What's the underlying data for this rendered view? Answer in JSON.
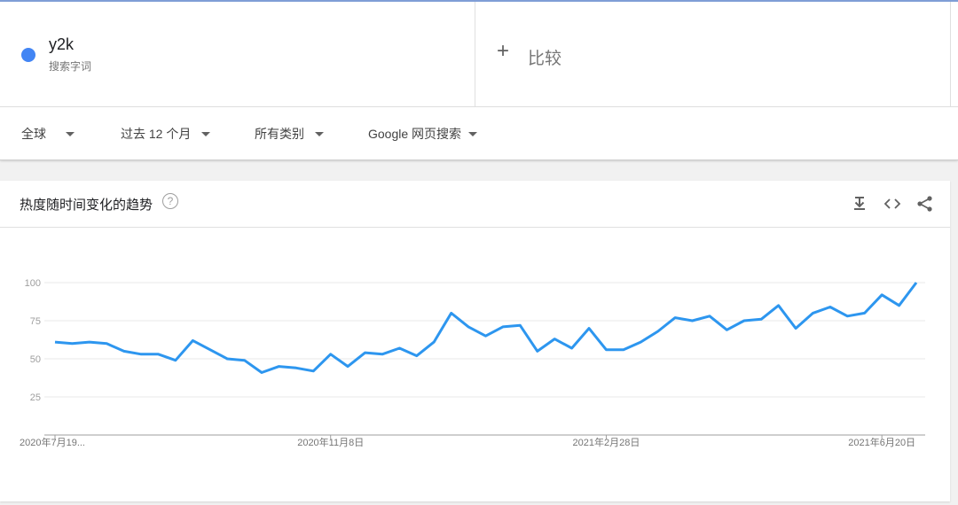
{
  "search_term": {
    "name": "y2k",
    "subtitle": "搜索字词",
    "color": "#4285f4"
  },
  "compare": {
    "icon": "plus-icon",
    "label": "比较"
  },
  "filters": [
    {
      "label": "全球"
    },
    {
      "label": "过去 12 个月"
    },
    {
      "label": "所有类别"
    },
    {
      "label": "Google 网页搜索"
    }
  ],
  "card": {
    "title": "热度随时间变化的趋势",
    "help_icon": "?",
    "icons": [
      "download-icon",
      "embed-code-icon",
      "share-icon"
    ]
  },
  "chart_data": {
    "type": "line",
    "title": "",
    "xlabel": "",
    "ylabel": "",
    "ylim": [
      0,
      100
    ],
    "yticks": [
      25,
      50,
      75,
      100
    ],
    "grid": true,
    "x_tick_labels": [
      "2020年7月19...",
      "2020年11月8日",
      "2021年2月28日",
      "2021年6月20日"
    ],
    "x": [
      "2020-07-19",
      "2020-07-26",
      "2020-08-02",
      "2020-08-09",
      "2020-08-16",
      "2020-08-23",
      "2020-08-30",
      "2020-09-06",
      "2020-09-13",
      "2020-09-20",
      "2020-09-27",
      "2020-10-04",
      "2020-10-11",
      "2020-10-18",
      "2020-10-25",
      "2020-11-01",
      "2020-11-08",
      "2020-11-15",
      "2020-11-22",
      "2020-11-29",
      "2020-12-06",
      "2020-12-13",
      "2020-12-20",
      "2020-12-27",
      "2021-01-03",
      "2021-01-10",
      "2021-01-17",
      "2021-01-24",
      "2021-01-31",
      "2021-02-07",
      "2021-02-14",
      "2021-02-21",
      "2021-02-28",
      "2021-03-07",
      "2021-03-14",
      "2021-03-21",
      "2021-03-28",
      "2021-04-04",
      "2021-04-11",
      "2021-04-18",
      "2021-04-25",
      "2021-05-02",
      "2021-05-09",
      "2021-05-16",
      "2021-05-23",
      "2021-05-30",
      "2021-06-06",
      "2021-06-13",
      "2021-06-20",
      "2021-06-27",
      "2021-07-04",
      "2021-07-11"
    ],
    "series": [
      {
        "color": "#2d96ef",
        "values": [
          61,
          60,
          61,
          60,
          55,
          53,
          53,
          49,
          62,
          56,
          50,
          49,
          41,
          45,
          44,
          42,
          53,
          45,
          54,
          53,
          57,
          52,
          61,
          80,
          71,
          65,
          71,
          72,
          55,
          63,
          57,
          70,
          56,
          56,
          61,
          68,
          77,
          75,
          78,
          69,
          75,
          76,
          85,
          70,
          80,
          84,
          78,
          80,
          92,
          85,
          100
        ]
      }
    ]
  }
}
